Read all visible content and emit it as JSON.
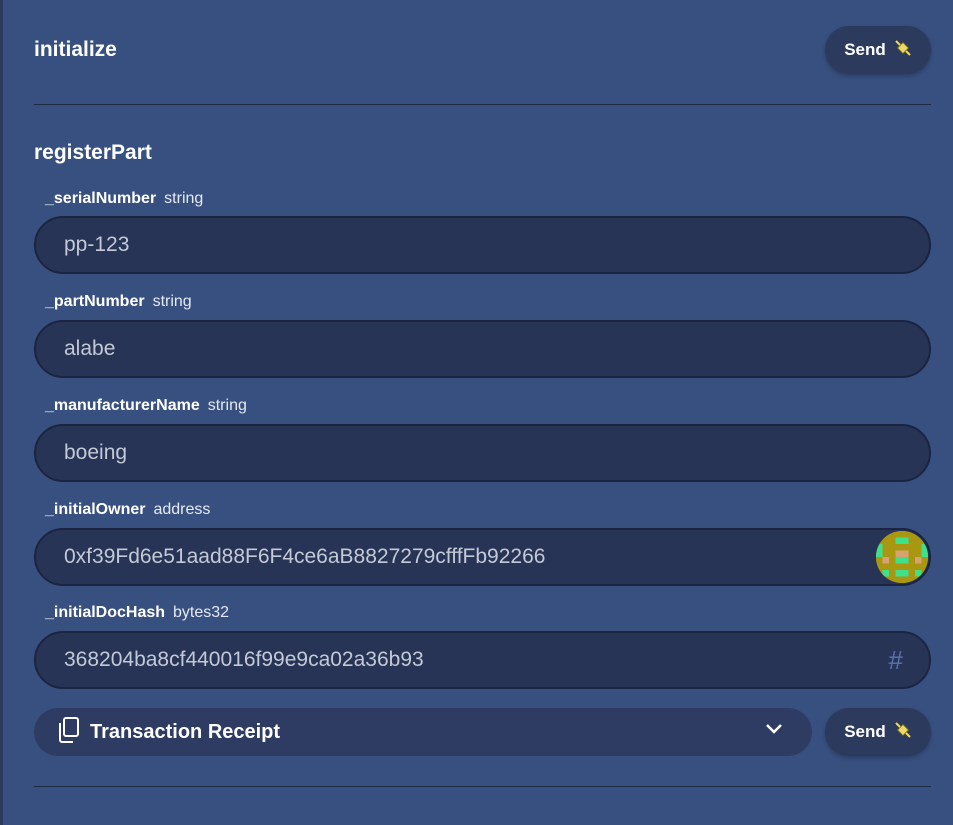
{
  "functions": {
    "initialize": {
      "title": "initialize",
      "send_label": "Send"
    },
    "registerPart": {
      "title": "registerPart",
      "send_label": "Send",
      "params": [
        {
          "name": "_serialNumber",
          "type": "string",
          "value": "pp-123"
        },
        {
          "name": "_partNumber",
          "type": "string",
          "value": "alabe"
        },
        {
          "name": "_manufacturerName",
          "type": "string",
          "value": "boeing"
        },
        {
          "name": "_initialOwner",
          "type": "address",
          "value": "0xf39Fd6e51aad88F6F4ce6aB8827279cfffFb92266"
        },
        {
          "name": "_initialDocHash",
          "type": "bytes32",
          "value": "368204ba8cf440016f99e9ca02a36b93"
        }
      ],
      "receipt": {
        "label": "Transaction Receipt"
      }
    }
  },
  "icons": {
    "send": "satellite-icon",
    "address": "identicon",
    "hash": "hash-icon",
    "receipt": "copy-icon",
    "expand": "chevron-down-icon"
  },
  "colors": {
    "background": "#385080",
    "field": "#283456",
    "button": "#2c3a5e",
    "hash_icon": "#5c73b0"
  }
}
